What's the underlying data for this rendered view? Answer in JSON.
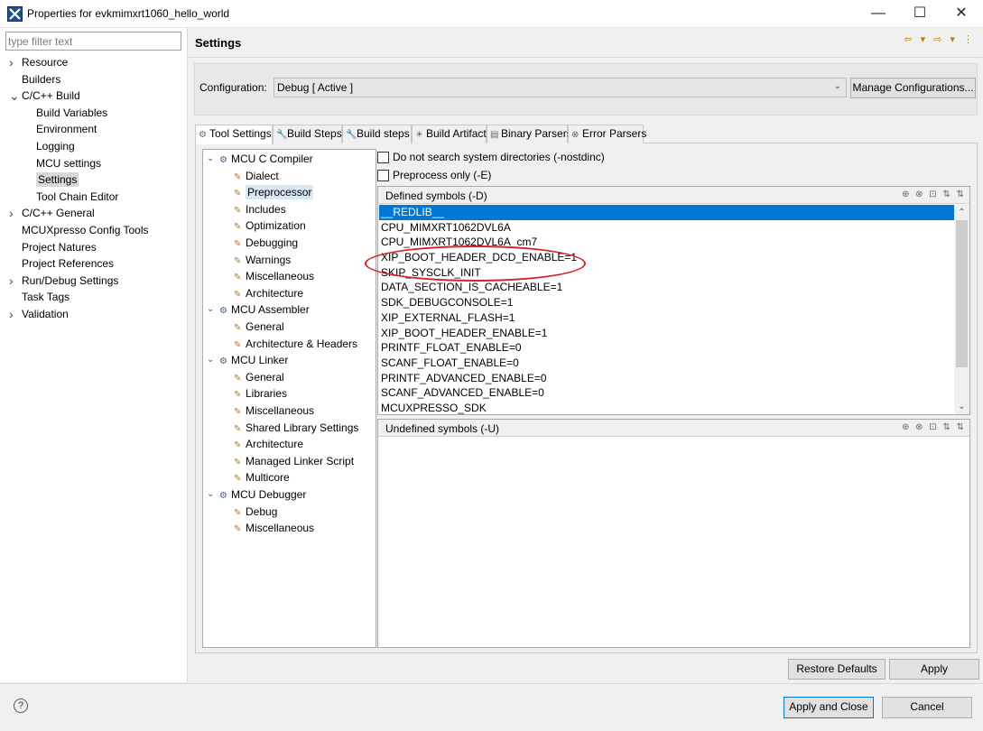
{
  "window": {
    "title": "Properties for evkmimxrt1060_hello_world",
    "minimize": "—",
    "maximize": "☐",
    "close": "✕"
  },
  "filter": {
    "placeholder": "type filter text"
  },
  "left_nav": {
    "items": [
      {
        "label": "Resource",
        "expand": "collapsed"
      },
      {
        "label": "Builders",
        "expand": "none"
      },
      {
        "label": "C/C++ Build",
        "expand": "expanded"
      },
      {
        "label": "Build Variables",
        "expand": "child"
      },
      {
        "label": "Environment",
        "expand": "child"
      },
      {
        "label": "Logging",
        "expand": "child"
      },
      {
        "label": "MCU settings",
        "expand": "child"
      },
      {
        "label": "Settings",
        "expand": "child",
        "selected": true
      },
      {
        "label": "Tool Chain Editor",
        "expand": "child"
      },
      {
        "label": "C/C++ General",
        "expand": "collapsed"
      },
      {
        "label": "MCUXpresso Config Tools",
        "expand": "none"
      },
      {
        "label": "Project Natures",
        "expand": "none"
      },
      {
        "label": "Project References",
        "expand": "none"
      },
      {
        "label": "Run/Debug Settings",
        "expand": "collapsed"
      },
      {
        "label": "Task Tags",
        "expand": "none"
      },
      {
        "label": "Validation",
        "expand": "collapsed"
      }
    ]
  },
  "page": {
    "title": "Settings",
    "nav_arrows": "⇦ ▾ ⇨ ▾ ⋮"
  },
  "configuration": {
    "label": "Configuration:",
    "value": "Debug  [ Active ]",
    "manage_button": "Manage Configurations..."
  },
  "tabs": [
    {
      "label": "Tool Settings",
      "icon": "tool-settings-icon",
      "glyph": "⚙",
      "active": true
    },
    {
      "label": "Build Steps",
      "icon": "wrench-icon",
      "glyph": "🔧"
    },
    {
      "label": "Build steps",
      "icon": "wrench-icon",
      "glyph": "🔧"
    },
    {
      "label": "Build Artifact",
      "icon": "artifact-icon",
      "glyph": "☀"
    },
    {
      "label": "Binary Parsers",
      "icon": "binary-parser-icon",
      "glyph": "▤"
    },
    {
      "label": "Error Parsers",
      "icon": "error-parser-icon",
      "glyph": "⊗"
    }
  ],
  "tool_tree": [
    {
      "label": "MCU C Compiler",
      "level": 0
    },
    {
      "label": "Dialect",
      "level": 1
    },
    {
      "label": "Preprocessor",
      "level": 1,
      "selected": true
    },
    {
      "label": "Includes",
      "level": 1
    },
    {
      "label": "Optimization",
      "level": 1
    },
    {
      "label": "Debugging",
      "level": 1
    },
    {
      "label": "Warnings",
      "level": 1
    },
    {
      "label": "Miscellaneous",
      "level": 1
    },
    {
      "label": "Architecture",
      "level": 1
    },
    {
      "label": "MCU Assembler",
      "level": 0
    },
    {
      "label": "General",
      "level": 1
    },
    {
      "label": "Architecture & Headers",
      "level": 1
    },
    {
      "label": "MCU Linker",
      "level": 0
    },
    {
      "label": "General",
      "level": 1
    },
    {
      "label": "Libraries",
      "level": 1
    },
    {
      "label": "Miscellaneous",
      "level": 1
    },
    {
      "label": "Shared Library Settings",
      "level": 1
    },
    {
      "label": "Architecture",
      "level": 1
    },
    {
      "label": "Managed Linker Script",
      "level": 1
    },
    {
      "label": "Multicore",
      "level": 1
    },
    {
      "label": "MCU Debugger",
      "level": 0
    },
    {
      "label": "Debug",
      "level": 1
    },
    {
      "label": "Miscellaneous",
      "level": 1
    }
  ],
  "options": {
    "nostdinc": {
      "label": "Do not search system directories (-nostdinc)",
      "checked": false
    },
    "preprocess_only": {
      "label": "Preprocess only (-E)",
      "checked": false
    }
  },
  "defined_symbols": {
    "header": "Defined symbols (-D)",
    "tool_icons": "⊕ ⊗ ⊡ ⇅ ⇅",
    "items": [
      "__REDLIB__",
      "CPU_MIMXRT1062DVL6A",
      "CPU_MIMXRT1062DVL6A_cm7",
      "XIP_BOOT_HEADER_DCD_ENABLE=1",
      "SKIP_SYSCLK_INIT",
      "DATA_SECTION_IS_CACHEABLE=1",
      "SDK_DEBUGCONSOLE=1",
      "XIP_EXTERNAL_FLASH=1",
      "XIP_BOOT_HEADER_ENABLE=1",
      "PRINTF_FLOAT_ENABLE=0",
      "SCANF_FLOAT_ENABLE=0",
      "PRINTF_ADVANCED_ENABLE=0",
      "SCANF_ADVANCED_ENABLE=0",
      "MCUXPRESSO_SDK"
    ],
    "selected_index": 0
  },
  "undefined_symbols": {
    "header": "Undefined symbols (-U)",
    "tool_icons": "⊕ ⊗ ⊡ ⇅ ⇅"
  },
  "buttons": {
    "restore_defaults": "Restore Defaults",
    "apply": "Apply",
    "apply_and_close": "Apply and Close",
    "cancel": "Cancel",
    "help": "?"
  },
  "colors": {
    "selection": "#0078d7",
    "annotation": "#d42020"
  }
}
